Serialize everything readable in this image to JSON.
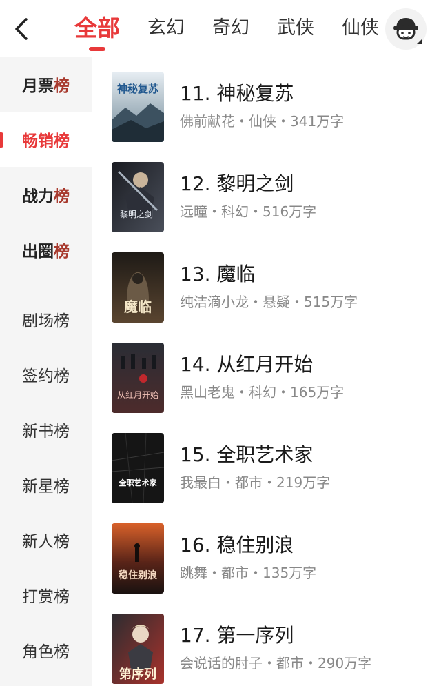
{
  "header": {
    "tabs": [
      {
        "label": "全部",
        "active": true
      },
      {
        "label": "玄幻",
        "active": false
      },
      {
        "label": "奇幻",
        "active": false
      },
      {
        "label": "武侠",
        "active": false
      },
      {
        "label": "仙侠",
        "active": false
      }
    ],
    "icons": {
      "back": "chevron-left-icon",
      "avatar": "user-avatar-icon"
    }
  },
  "sidebar": {
    "items": [
      {
        "prefix": "月票",
        "suffix": "榜",
        "style": "strong"
      },
      {
        "prefix": "畅销",
        "suffix": "榜",
        "style": "active"
      },
      {
        "prefix": "战力",
        "suffix": "榜",
        "style": "strong"
      },
      {
        "prefix": "出圈",
        "suffix": "榜",
        "style": "strong"
      },
      {
        "label": "剧场榜"
      },
      {
        "label": "签约榜"
      },
      {
        "label": "新书榜"
      },
      {
        "label": "新星榜"
      },
      {
        "label": "新人榜"
      },
      {
        "label": "打赏榜"
      },
      {
        "label": "角色榜"
      }
    ]
  },
  "books": [
    {
      "title": "11. 神秘复苏",
      "meta": "佛前献花・仙侠・341万字",
      "cover_text": "神秘复苏"
    },
    {
      "title": "12. 黎明之剑",
      "meta": "远瞳・科幻・516万字",
      "cover_text": "黎明之剑"
    },
    {
      "title": "13. 魔临",
      "meta": "纯洁滴小龙・悬疑・515万字",
      "cover_text": "魔临"
    },
    {
      "title": "14. 从红月开始",
      "meta": "黑山老鬼・科幻・165万字",
      "cover_text": "从红月开始"
    },
    {
      "title": "15. 全职艺术家",
      "meta": "我最白・都市・219万字",
      "cover_text": "全职艺术家"
    },
    {
      "title": "16. 稳住别浪",
      "meta": "跳舞・都市・135万字",
      "cover_text": "稳住别浪"
    },
    {
      "title": "17. 第一序列",
      "meta": "会说话的肘子・都市・290万字",
      "cover_text": "第序列"
    }
  ],
  "colors": {
    "accent": "#e8393a",
    "sidebar_bg": "#f5f5f5",
    "meta": "#888888"
  }
}
